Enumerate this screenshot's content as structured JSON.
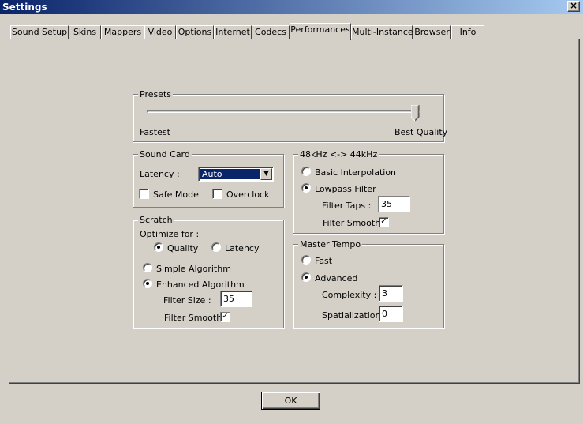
{
  "window": {
    "title": "Settings",
    "close_glyph": "×"
  },
  "tabs": [
    {
      "label": "Sound Setup"
    },
    {
      "label": "Skins"
    },
    {
      "label": "Mappers"
    },
    {
      "label": "Video"
    },
    {
      "label": "Options"
    },
    {
      "label": "Internet"
    },
    {
      "label": "Codecs"
    },
    {
      "label": "Performances",
      "active": true
    },
    {
      "label": "Multi-Instance"
    },
    {
      "label": "Browser"
    },
    {
      "label": "Info"
    }
  ],
  "presets": {
    "title": "Presets",
    "min_label": "Fastest",
    "max_label": "Best Quality",
    "slider_value": 1.0
  },
  "sound_card": {
    "title": "Sound Card",
    "latency_label": "Latency :",
    "latency_value": "Auto",
    "safe_mode_label": "Safe Mode",
    "safe_mode_checked": false,
    "overclock_label": "Overclock",
    "overclock_checked": false
  },
  "scratch": {
    "title": "Scratch",
    "optimize_label": "Optimize for :",
    "quality_label": "Quality",
    "latency_label": "Latency",
    "optimize_selected": "Quality",
    "simple_label": "Simple Algorithm",
    "enhanced_label": "Enhanced Algorithm",
    "algorithm_selected": "Enhanced Algorithm",
    "filter_size_label": "Filter Size :",
    "filter_size_value": "35",
    "filter_smooth_label": "Filter Smooth",
    "filter_smooth_checked": true
  },
  "resample": {
    "title": "48kHz <-> 44kHz",
    "basic_label": "Basic Interpolation",
    "lowpass_label": "Lowpass Filter",
    "selected": "Lowpass Filter",
    "filter_taps_label": "Filter Taps :",
    "filter_taps_value": "35",
    "filter_smooth_label": "Filter Smooth",
    "filter_smooth_checked": true
  },
  "master_tempo": {
    "title": "Master Tempo",
    "fast_label": "Fast",
    "advanced_label": "Advanced",
    "selected": "Advanced",
    "complexity_label": "Complexity :",
    "complexity_value": "3",
    "spatialization_label": "Spatialization :",
    "spatialization_value": "0"
  },
  "ok_button": {
    "label": "OK"
  },
  "glyphs": {
    "check": "✓",
    "dropdown": "▼"
  }
}
